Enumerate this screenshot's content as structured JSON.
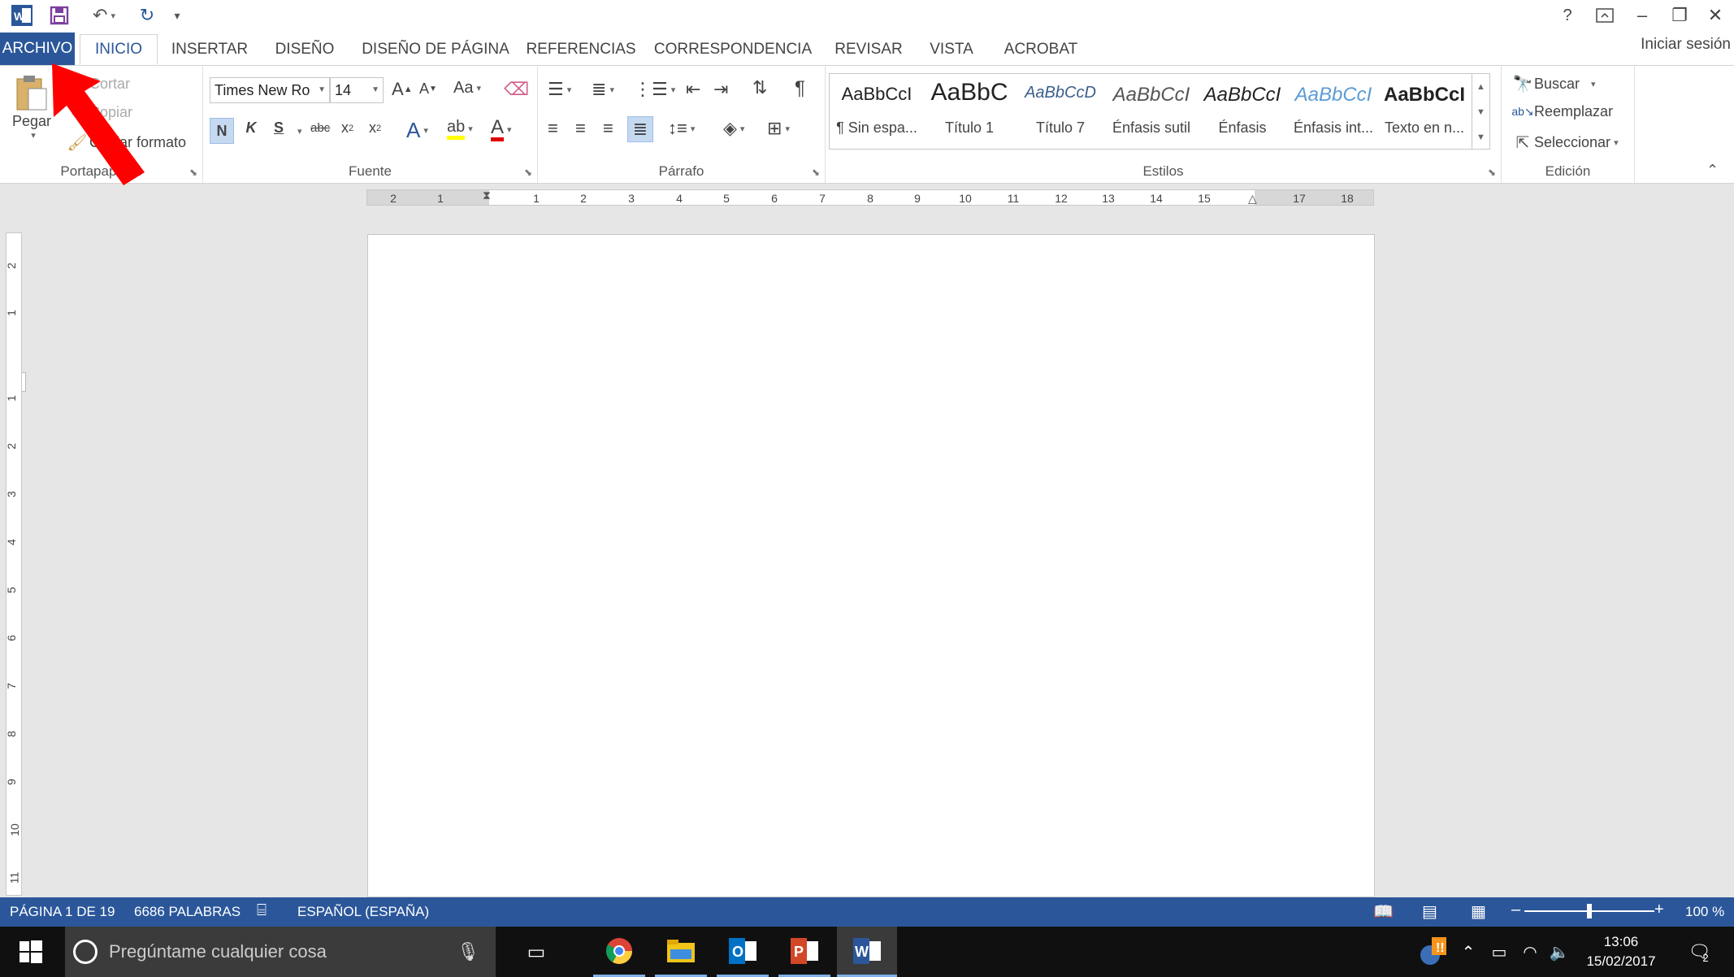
{
  "quick_access": {
    "redo_icon": "repeat-icon",
    "customize_icon": "customize-icon"
  },
  "window": {
    "help": "?",
    "minimize": "–",
    "restore": "❐",
    "close": "✕",
    "signin": "Iniciar sesión"
  },
  "tabs": [
    {
      "label": "ARCHIVO"
    },
    {
      "label": "INICIO"
    },
    {
      "label": "INSERTAR"
    },
    {
      "label": "DISEÑO"
    },
    {
      "label": "DISEÑO DE PÁGINA"
    },
    {
      "label": "REFERENCIAS"
    },
    {
      "label": "CORRESPONDENCIA"
    },
    {
      "label": "REVISAR"
    },
    {
      "label": "VISTA"
    },
    {
      "label": "ACROBAT"
    }
  ],
  "clipboard": {
    "paste": "Pegar",
    "cut": "Cortar",
    "copy": "Copiar",
    "format_painter": "Copiar formato",
    "group": "Portapapeles"
  },
  "font": {
    "name": "Times New Ro",
    "size": "14",
    "change_case": "Aa",
    "bold": "N",
    "italic": "K",
    "underline": "S",
    "strike": "abc",
    "group": "Fuente"
  },
  "paragraph": {
    "group": "Párrafo"
  },
  "styles": {
    "group": "Estilos",
    "items": [
      {
        "preview": "AaBbCcI",
        "name": "¶ Sin espa..."
      },
      {
        "preview": "AaBbC",
        "name": "Título 1"
      },
      {
        "preview": "AaBbCcD",
        "name": "Título 7"
      },
      {
        "preview": "AaBbCcI",
        "name": "Énfasis sutil"
      },
      {
        "preview": "AaBbCcI",
        "name": "Énfasis"
      },
      {
        "preview": "AaBbCcI",
        "name": "Énfasis int..."
      },
      {
        "preview": "AaBbCcI",
        "name": "Texto en n..."
      }
    ]
  },
  "editing": {
    "find": "Buscar",
    "replace": "Reemplazar",
    "select": "Seleccionar",
    "group": "Edición"
  },
  "ruler": {
    "h_ticks": [
      "2",
      "1",
      "1",
      "2",
      "3",
      "4",
      "5",
      "6",
      "7",
      "8",
      "9",
      "10",
      "11",
      "12",
      "13",
      "14",
      "15",
      "17",
      "18"
    ],
    "v_ticks": [
      "2",
      "1",
      "1",
      "2",
      "3",
      "4",
      "5",
      "6",
      "7",
      "8",
      "9",
      "10",
      "11"
    ]
  },
  "status": {
    "page": "PÁGINA 1 DE 19",
    "words": "6686 PALABRAS",
    "language": "ESPAÑOL (ESPAÑA)",
    "zoom_minus": "–",
    "zoom_plus": "+",
    "zoom": "100 %",
    "zoom_level": 0.5
  },
  "taskbar": {
    "search_placeholder": "Pregúntame cualquier cosa",
    "time": "13:06",
    "date": "15/02/2017",
    "notifications": "2"
  }
}
